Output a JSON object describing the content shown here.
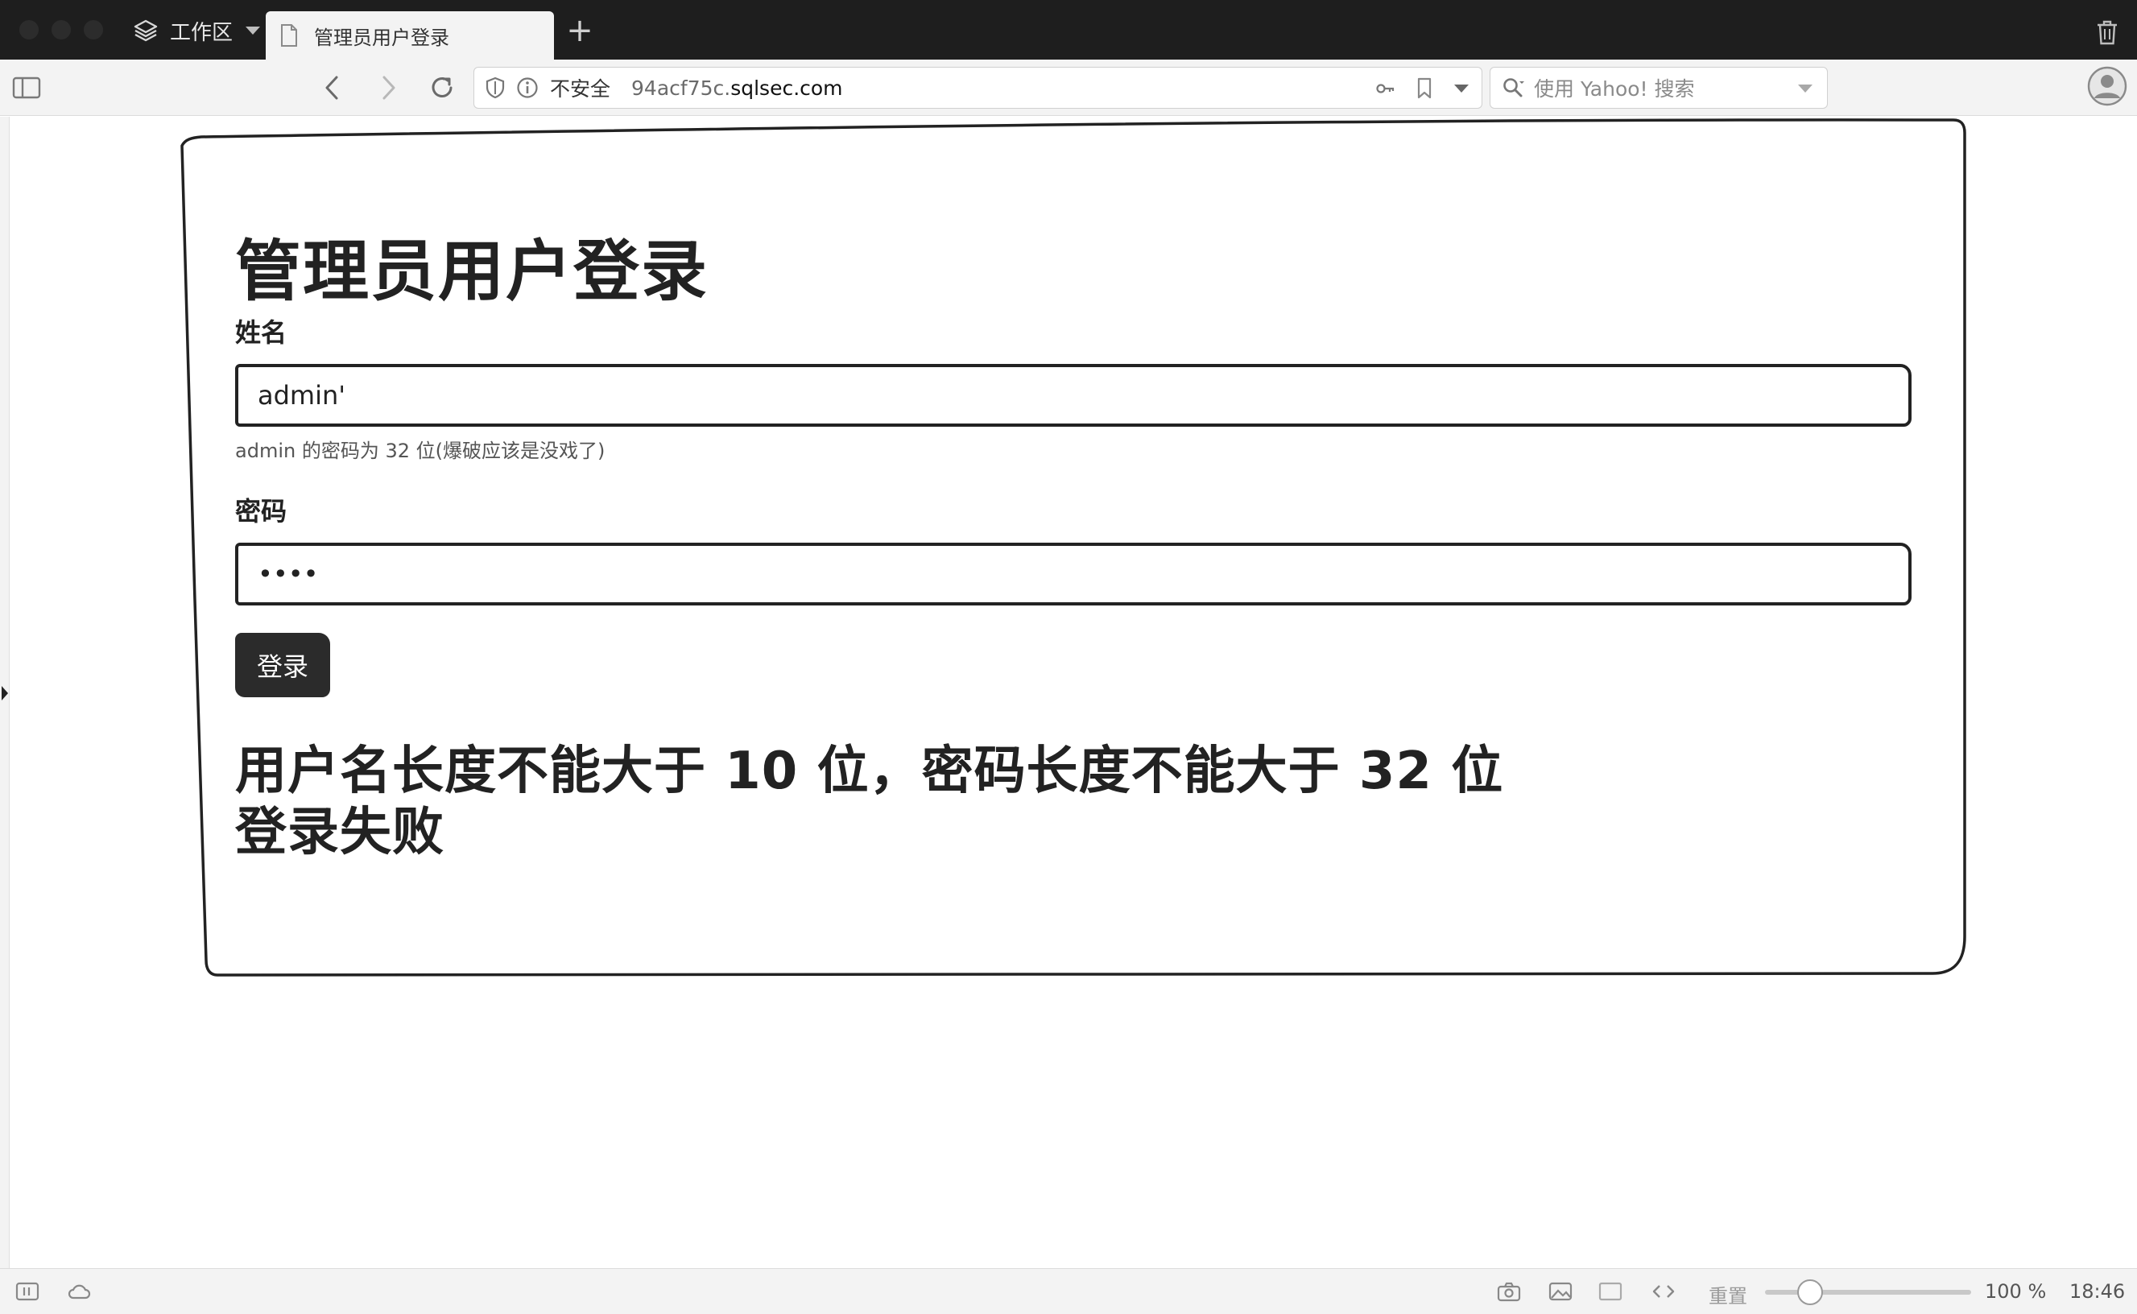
{
  "browser": {
    "workspace_label": "工作区",
    "tab_title": "管理员用户登录",
    "new_tab": "+",
    "address": {
      "security_label": "不安全",
      "url_sub": "94acf75c.",
      "url_domain": "sqlsec.com"
    },
    "search_placeholder": "使用 Yahoo! 搜索"
  },
  "page": {
    "title": "管理员用户登录",
    "username_label": "姓名",
    "username_value": "admin'",
    "username_hint": "admin 的密码为 32 位(爆破应该是没戏了)",
    "password_label": "密码",
    "password_value": "••••",
    "login_button": "登录",
    "message_line1": "用户名长度不能大于 10 位，密码长度不能大于 32 位",
    "message_line2": "登录失败"
  },
  "statusbar": {
    "reset_label": "重置",
    "zoom_value": "100 %",
    "time": "18:46"
  },
  "colors": {
    "tabbar_bg": "#1e1e1e",
    "toolbar_bg": "#f3f3f3",
    "ink": "#222222",
    "button_bg": "#2b2b2b"
  },
  "icons": [
    "workspace-stack-icon",
    "document-icon",
    "trash-icon",
    "sidebar-toggle-icon",
    "back-icon",
    "forward-icon",
    "reload-icon",
    "shield-icon",
    "info-icon",
    "key-icon",
    "bookmark-icon",
    "chevron-down-icon",
    "search-icon",
    "profile-icon",
    "panel-icon",
    "cloud-icon",
    "camera-icon",
    "image-icon",
    "window-icon",
    "code-icon"
  ]
}
